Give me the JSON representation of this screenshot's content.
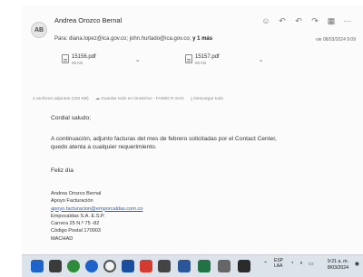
{
  "email": {
    "avatar_initials": "AB",
    "sender": "Andrea Orozco Bernal",
    "recipients_prefix": "Para:",
    "recipients_list": "diana.lopez@ica.gov.co; john.hurtado@ica.gov.co;",
    "recipients_more": "y 1 más",
    "date": "vie 08/03/2024 9:09",
    "toolbar": [
      "☺",
      "↶",
      "↶",
      "↷",
      "▦",
      "⋯"
    ]
  },
  "attachments": [
    {
      "name": "15156.pdf",
      "size": "89 KB"
    },
    {
      "name": "15157.pdf",
      "size": "88 KB"
    }
  ],
  "attachment_info": {
    "count": "2 archivos adjuntos (192 KB)",
    "save_onedrive": "Guardar todo en OneDrive - FAMIO R.SAS",
    "download_all": "Descargar todo"
  },
  "message": {
    "greeting": "Cordial saludo;",
    "line1": "A continuación, adjunto facturas del mes de febrero solicitadas por el Contact Center,",
    "line2": "quedo atenta a cualquier requerimiento.",
    "closing": "Feliz día"
  },
  "signature": {
    "name": "Andrea Orozco Bernal",
    "role": "Apoyo Facturación",
    "email": "apoyo.facturacion@emporcaldas.com.co",
    "company": "Empocaldas S.A. E.S.P.",
    "address": "Carrera 25 N.º 75 -82",
    "postal": "Código Postal 170003",
    "city": "MACHAD"
  },
  "taskbar": {
    "lang_1": "ESP",
    "lang_2": "LAA",
    "time": "9:21 a. m.",
    "date": "8/03/2024"
  },
  "colors": {
    "taskbar": "#dde3ea",
    "link": "#2f5fb5",
    "icon_blue": "#1e63c9",
    "icon_green": "#2e8b3a",
    "icon_red": "#d43b2e"
  }
}
